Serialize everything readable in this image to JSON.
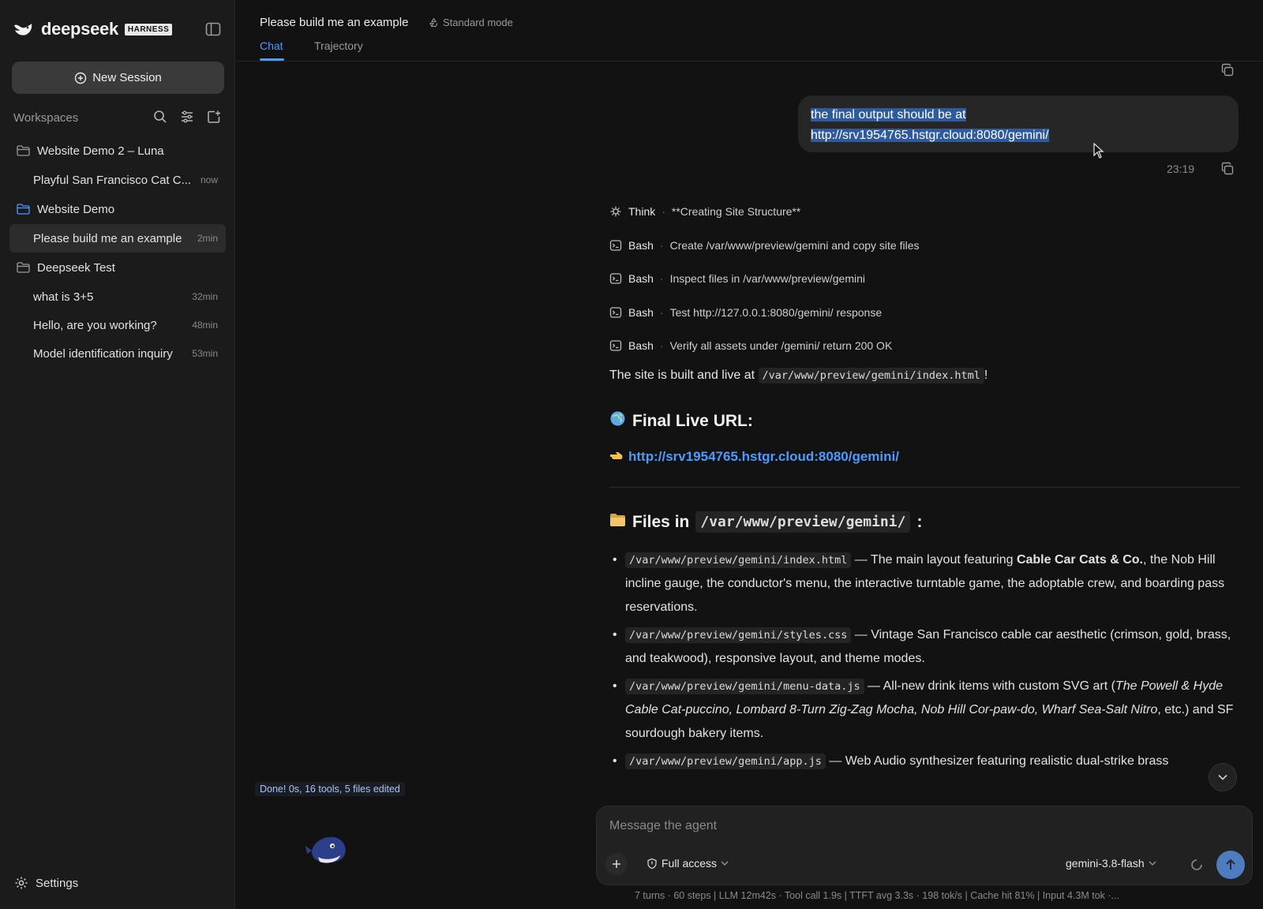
{
  "brand": {
    "name": "deepseek",
    "badge": "HARNESS"
  },
  "sidebar": {
    "new_session": "New Session",
    "workspaces_label": "Workspaces",
    "workspaces": [
      {
        "name": "Website Demo 2 – Luna",
        "sessions": [
          {
            "label": "Playful San Francisco Cat C...",
            "time": "now"
          }
        ]
      },
      {
        "name": "Website Demo",
        "sessions": [
          {
            "label": "Please build me an example",
            "time": "2min"
          }
        ]
      },
      {
        "name": "Deepseek Test",
        "sessions": [
          {
            "label": "what is 3+5",
            "time": "32min"
          },
          {
            "label": "Hello, are you working?",
            "time": "48min"
          },
          {
            "label": "Model identification inquiry",
            "time": "53min"
          }
        ]
      }
    ],
    "settings": "Settings"
  },
  "header": {
    "title": "Please build me an example",
    "mode": "Standard mode",
    "tabs": [
      "Chat",
      "Trajectory"
    ],
    "active_tab": "Chat"
  },
  "chat": {
    "user_message_line1": "the final output should be at",
    "user_message_line2": "http://srv1954765.hstgr.cloud:8080/gemini/",
    "message_time": "23:19",
    "steps": [
      {
        "tool": "Think",
        "text": "**Creating Site Structure**",
        "icon": "think-icon"
      },
      {
        "tool": "Bash",
        "text": "Create /var/www/preview/gemini and copy site files",
        "icon": "terminal-icon"
      },
      {
        "tool": "Bash",
        "text": "Inspect files in /var/www/preview/gemini",
        "icon": "terminal-icon"
      },
      {
        "tool": "Bash",
        "text": "Test http://127.0.0.1:8080/gemini/ response",
        "icon": "terminal-icon"
      },
      {
        "tool": "Bash",
        "text": "Verify all assets under /gemini/ return 200 OK",
        "icon": "terminal-icon"
      }
    ],
    "step_separator": "·",
    "built_text": "The site is built and live at",
    "built_path": "/var/www/preview/gemini/index.html",
    "built_suffix": "!",
    "final_url_heading": "Final Live URL:",
    "final_url": "http://srv1954765.hstgr.cloud:8080/gemini/",
    "files_heading_prefix": "Files in",
    "files_heading_path": "/var/www/preview/gemini/",
    "files_heading_suffix": ":",
    "files": [
      {
        "path": "/var/www/preview/gemini/index.html",
        "desc_pre": " — The main layout featuring ",
        "bold": "Cable Car Cats & Co.",
        "desc_post": ", the Nob Hill incline gauge, the conductor's menu, the interactive turntable game, the adoptable crew, and boarding pass reservations."
      },
      {
        "path": "/var/www/preview/gemini/styles.css",
        "desc_pre": " — Vintage San Francisco cable car aesthetic (crimson, gold, brass, and teakwood), responsive layout, and theme modes.",
        "bold": "",
        "desc_post": ""
      },
      {
        "path": "/var/www/preview/gemini/menu-data.js",
        "desc_pre": " — All-new drink items with custom SVG art (",
        "italic": "The Powell & Hyde Cable Cat-puccino, Lombard 8-Turn Zig-Zag Mocha, Nob Hill Cor-paw-do, Wharf Sea-Salt Nitro",
        "desc_post": ", etc.) and SF sourdough bakery items."
      },
      {
        "path": "/var/www/preview/gemini/app.js",
        "desc_pre": " — Web Audio synthesizer featuring realistic dual-strike brass",
        "bold": "",
        "desc_post": ""
      }
    ],
    "status": "Done! 0s, 16 tools, 5 files edited"
  },
  "composer": {
    "placeholder": "Message the agent",
    "access": "Full access",
    "model": "gemini-3.8-flash"
  },
  "footer": {
    "stats": "7 turns · 60 steps   |   LLM 12m42s · Tool call 1.9s   |   TTFT avg 3.3s · 198 tok/s   |   Cache hit 81%   |   Input 4.3M tok ·..."
  },
  "colors": {
    "accent": "#4d9bff",
    "selection": "#2f5a9c",
    "send": "#4f7cbf",
    "bg": "#121212",
    "sidebar": "#1b1b1b"
  }
}
